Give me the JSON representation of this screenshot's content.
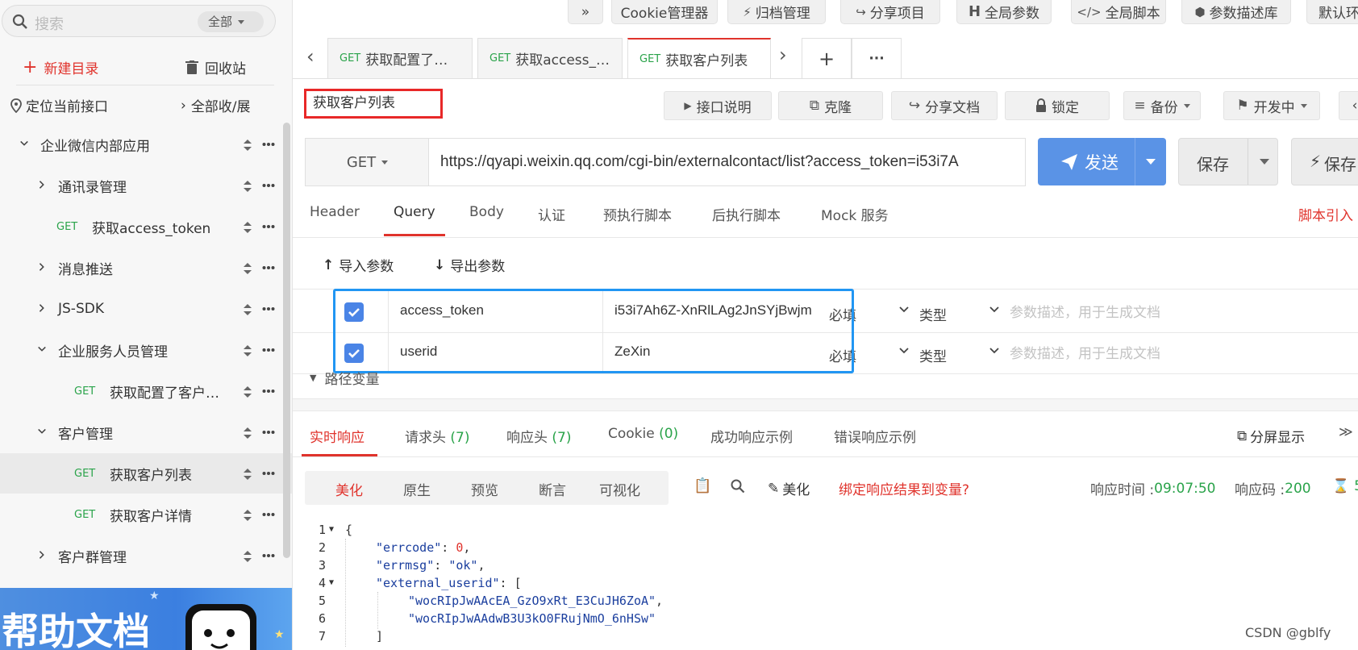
{
  "sidebar": {
    "search_placeholder": "搜索",
    "search_scope": "全部",
    "new_dir": "新建目录",
    "recycle": "回收站",
    "locate": "定位当前接口",
    "toggle_all": "全部收/展",
    "tree": [
      {
        "label": "企业微信内部应用",
        "type": "folder",
        "expanded": true
      },
      {
        "label": "通讯录管理",
        "type": "folder",
        "expanded": false
      },
      {
        "label": "获取access_token",
        "type": "api",
        "method": "GET"
      },
      {
        "label": "消息推送",
        "type": "folder",
        "expanded": false
      },
      {
        "label": "JS-SDK",
        "type": "folder",
        "expanded": false
      },
      {
        "label": "企业服务人员管理",
        "type": "folder",
        "expanded": true
      },
      {
        "label": "获取配置了客户…",
        "type": "api",
        "method": "GET"
      },
      {
        "label": "客户管理",
        "type": "folder",
        "expanded": true
      },
      {
        "label": "获取客户列表",
        "type": "api",
        "method": "GET",
        "active": true
      },
      {
        "label": "获取客户详情",
        "type": "api",
        "method": "GET"
      },
      {
        "label": "客户群管理",
        "type": "folder",
        "expanded": false
      }
    ],
    "help_banner": "帮助文档"
  },
  "toolbar": {
    "expand": "»",
    "items": [
      "Cookie管理器",
      "归档管理",
      "分享项目",
      "全局参数",
      "全局脚本",
      "参数描述库",
      "默认环"
    ],
    "global_params_prefix": "H"
  },
  "tabs": [
    {
      "method": "GET",
      "label": "获取配置了…"
    },
    {
      "method": "GET",
      "label": "获取access_…"
    },
    {
      "method": "GET",
      "label": "获取客户列表",
      "active": true
    }
  ],
  "tab_controls": {
    "prev": "‹",
    "next": "›",
    "add": "+",
    "more": "···"
  },
  "api": {
    "name": "获取客户列表",
    "method": "GET",
    "url": "https://qyapi.weixin.qq.com/cgi-bin/externalcontact/list?access_token=i53i7A",
    "buttons": {
      "doc": "接口说明",
      "clone": "克隆",
      "share": "分享文档",
      "lock": "锁定",
      "backup": "备份",
      "status": "开发中"
    },
    "send": "发送",
    "save": "保存",
    "save2": "保存"
  },
  "req_tabs": [
    "Header",
    "Query",
    "Body",
    "认证",
    "预执行脚本",
    "后执行脚本",
    "Mock 服务"
  ],
  "req_tab_active": "Query",
  "script_import": "脚本引入",
  "params": {
    "import": "导入参数",
    "export": "导出参数",
    "rows": [
      {
        "key": "access_token",
        "value": "i53i7Ah6Z-XnRlLAg2JnSYjBwjm",
        "required": "必填",
        "type": "类型",
        "desc_placeholder": "参数描述，用于生成文档",
        "checked": true
      },
      {
        "key": "userid",
        "value": "ZeXin",
        "required": "必填",
        "type": "类型",
        "desc_placeholder": "参数描述，用于生成文档",
        "checked": true
      }
    ],
    "path_vars": "路径变量"
  },
  "response": {
    "tabs": [
      {
        "label": "实时响应",
        "active": true
      },
      {
        "label": "请求头 ",
        "count": "(7)"
      },
      {
        "label": "响应头 ",
        "count": "(7)"
      },
      {
        "label": "Cookie ",
        "count": "(0)"
      },
      {
        "label": "成功响应示例"
      },
      {
        "label": "错误响应示例"
      }
    ],
    "split_view": "分屏显示",
    "formats": [
      "美化",
      "原生",
      "预览",
      "断言",
      "可视化"
    ],
    "format_active": "美化",
    "beautify": "美化",
    "bind_var": "绑定响应结果到变量?",
    "time_label": "响应时间 : ",
    "time_value": "09:07:50",
    "code_label": "响应码 : ",
    "code_value": "200",
    "extra": "5",
    "code": [
      {
        "n": "1",
        "fold": true
      },
      {
        "n": "2"
      },
      {
        "n": "3"
      },
      {
        "n": "4",
        "fold": true
      },
      {
        "n": "5"
      },
      {
        "n": "6"
      },
      {
        "n": "7"
      }
    ],
    "json": {
      "errcode_key": "\"errcode\"",
      "errcode_val": "0",
      "errmsg_key": "\"errmsg\"",
      "errmsg_val": "\"ok\"",
      "ext_key": "\"external_userid\"",
      "id1": "\"wocRIpJwAAcEA_GzO9xRt_E3CuJH6ZoA\"",
      "id2": "\"wocRIpJwAAdwB3U3kO0FRujNmO_6nHSw\""
    }
  },
  "watermark": "CSDN @gblfy",
  "colors": {
    "accent": "#e0332c",
    "primary": "#5a93e6",
    "get": "#2aa34a",
    "highlight_red": "#e82828",
    "highlight_blue": "#2196f3"
  }
}
